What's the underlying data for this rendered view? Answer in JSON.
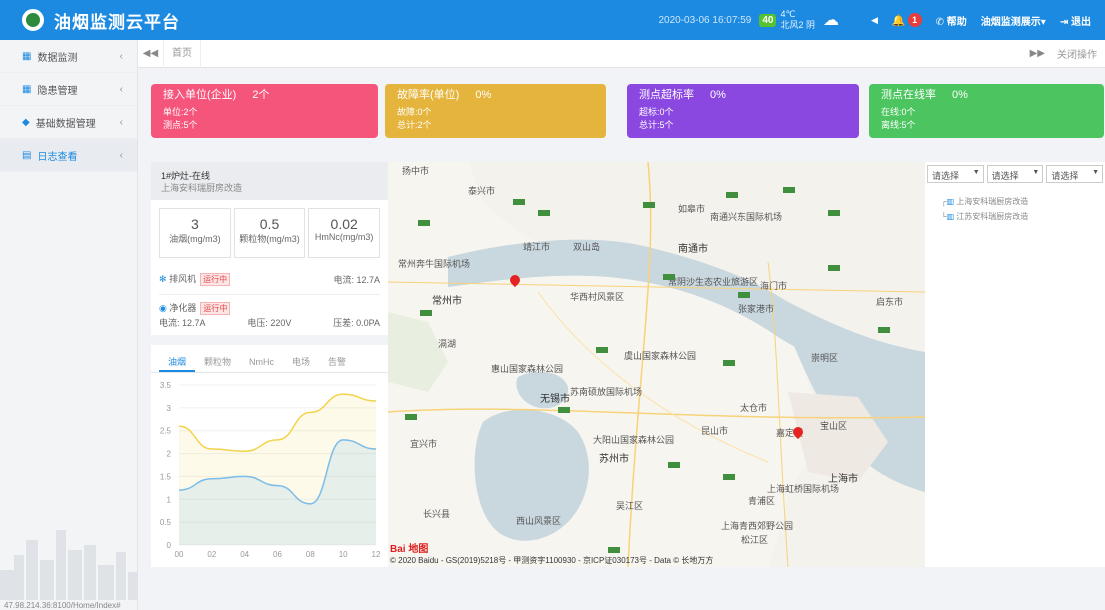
{
  "header": {
    "title": "油烟监测云平台",
    "datetime": "2020-03-06 16:07:59",
    "aqi": "40",
    "temperature": "4℃",
    "wind": "北风2",
    "sky": "阴",
    "alert_count": "1",
    "help": "帮助",
    "user_menu": "油烟监测展示",
    "logout": "退出"
  },
  "sidebar": {
    "items": [
      {
        "label": "数据监测",
        "icon": "calendar-icon"
      },
      {
        "label": "隐患管理",
        "icon": "calendar-icon"
      },
      {
        "label": "基础数据管理",
        "icon": "layers-icon"
      },
      {
        "label": "日志查看",
        "icon": "log-icon"
      }
    ],
    "url": "47.98.214.36:8100/Home/Index#"
  },
  "tabs": {
    "back": "◀◀",
    "home": "首页",
    "forward": "▶▶",
    "close_op": "关闭操作"
  },
  "stats": [
    {
      "title": "接入单位(企业)",
      "value": "2个",
      "line1": "单位:2个",
      "line2": "测点:5个",
      "color": "#f5557b"
    },
    {
      "title": "故障率(单位)",
      "value": "0%",
      "line1": "故障:0个",
      "line2": "总计:2个",
      "color": "#e4b43c"
    },
    {
      "title": "测点超标率",
      "value": "0%",
      "line1": "超标:0个",
      "line2": "总计:5个",
      "color": "#8b48e0"
    },
    {
      "title": "测点在线率",
      "value": "0%",
      "line1": "在线:0个",
      "line2": "离线:5个",
      "color": "#4cc560"
    }
  ],
  "panel": {
    "name": "1#炉灶-在线",
    "company": "上海安科瑞厨房改造",
    "metrics": [
      {
        "value": "3",
        "unit": "油烟(mg/m3)"
      },
      {
        "value": "0.5",
        "unit": "颗粒物(mg/m3)"
      },
      {
        "value": "0.02",
        "unit": "HmNc(mg/m3)"
      }
    ],
    "fan_label": "排风机",
    "fan_status": "运行中",
    "fan_current": "电流: 12.7A",
    "purifier_label": "净化器",
    "purifier_status": "运行中",
    "purifier_current": "电流: 12.7A",
    "purifier_voltage": "电压: 220V",
    "purifier_pressure": "压差: 0.0PA",
    "chart_tabs": [
      "油烟",
      "颗粒物",
      "NmHc",
      "电场",
      "告警"
    ]
  },
  "chart_data": {
    "type": "area",
    "x": [
      "00",
      "02",
      "04",
      "06",
      "08",
      "10",
      "12"
    ],
    "ylim": [
      0,
      3.5
    ],
    "yticks": [
      "0",
      "0.5",
      "1",
      "1.5",
      "2",
      "2.5",
      "3",
      "3.5"
    ],
    "series": [
      {
        "values": [
          2.6,
          2.1,
          2.05,
          2.3,
          2.9,
          3.3,
          3.15
        ],
        "color": "#f3d34a"
      },
      {
        "values": [
          1.2,
          1.45,
          1.5,
          1.3,
          0.9,
          2.3,
          2.1
        ],
        "color": "#7bbde8"
      }
    ]
  },
  "map": {
    "labels": [
      {
        "text": "扬中市",
        "cls": ""
      },
      {
        "text": "泰兴市",
        "cls": ""
      },
      {
        "text": "如皋市",
        "cls": ""
      },
      {
        "text": "南通兴东国际机场",
        "cls": ""
      },
      {
        "text": "南通市",
        "cls": "big"
      },
      {
        "text": "常州奔牛国际机场",
        "cls": ""
      },
      {
        "text": "常州市",
        "cls": "big"
      },
      {
        "text": "靖江市",
        "cls": ""
      },
      {
        "text": "双山岛",
        "cls": ""
      },
      {
        "text": "华西村风景区",
        "cls": ""
      },
      {
        "text": "常阴沙生态农业旅游区",
        "cls": ""
      },
      {
        "text": "海门市",
        "cls": ""
      },
      {
        "text": "启东市",
        "cls": ""
      },
      {
        "text": "张家港市",
        "cls": ""
      },
      {
        "text": "滆湖",
        "cls": ""
      },
      {
        "text": "惠山国家森林公园",
        "cls": ""
      },
      {
        "text": "虞山国家森林公园",
        "cls": ""
      },
      {
        "text": "无锡市",
        "cls": "big"
      },
      {
        "text": "苏南硕放国际机场",
        "cls": ""
      },
      {
        "text": "太仓市",
        "cls": ""
      },
      {
        "text": "崇明区",
        "cls": ""
      },
      {
        "text": "宜兴市",
        "cls": ""
      },
      {
        "text": "大阳山国家森林公园",
        "cls": ""
      },
      {
        "text": "苏州市",
        "cls": "big"
      },
      {
        "text": "昆山市",
        "cls": ""
      },
      {
        "text": "嘉定区",
        "cls": ""
      },
      {
        "text": "宝山区",
        "cls": ""
      },
      {
        "text": "上海虹桥国际机场",
        "cls": ""
      },
      {
        "text": "上海市",
        "cls": "big"
      },
      {
        "text": "青浦区",
        "cls": ""
      },
      {
        "text": "吴江区",
        "cls": ""
      },
      {
        "text": "西山风景区",
        "cls": ""
      },
      {
        "text": "上海青西郊野公园",
        "cls": ""
      },
      {
        "text": "松江区",
        "cls": ""
      },
      {
        "text": "长兴县",
        "cls": ""
      }
    ],
    "baidu": "Bai 地图",
    "copyright": "© 2020 Baidu - GS(2019)5218号 - 甲测资字1100930 - 京ICP证030173号 - Data © 长地万方"
  },
  "right": {
    "selects": [
      "请选择",
      "请选择",
      "请选择"
    ],
    "tree": [
      "上海安科瑞厨房改造",
      "江苏安科瑞厨房改造"
    ]
  }
}
